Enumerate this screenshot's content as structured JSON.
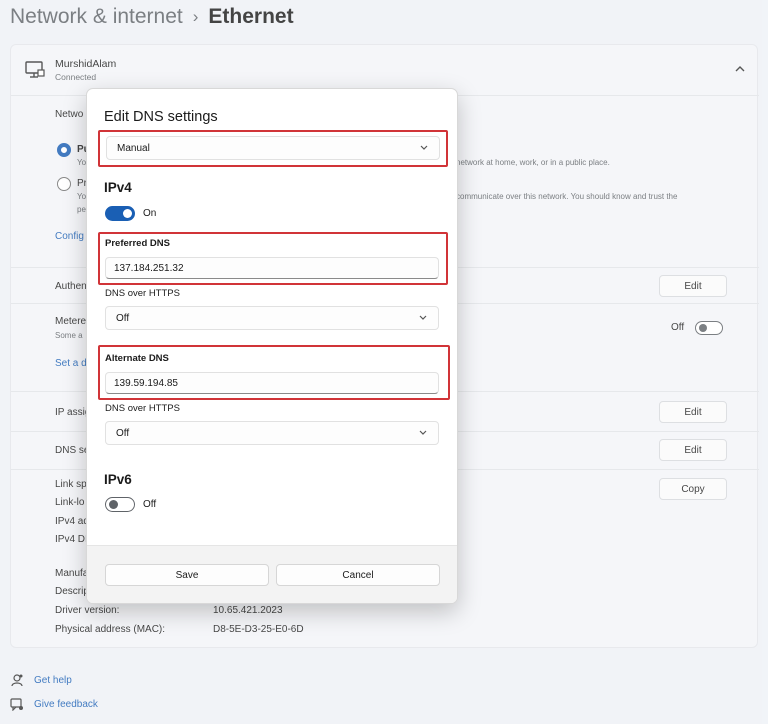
{
  "breadcrumb": {
    "parent": "Network & internet",
    "separator": "›",
    "current": "Ethernet"
  },
  "network": {
    "name": "MurshidAlam",
    "status": "Connected"
  },
  "background": {
    "network_profile_label": "Netwo",
    "public_label": "Pu",
    "public_desc_start": "Yo",
    "public_desc_end": "network at home, work, or in a public place.",
    "private_label": "Pr",
    "private_desc_start": "Yo",
    "private_desc_cont": "pe",
    "private_desc_end": "communicate over this network. You should know and trust the",
    "configure_link": "Config",
    "auth_label": "Authen",
    "auth_button": "Edit",
    "metered_label": "Metere",
    "metered_desc": "Some a",
    "metered_toggle_label": "Off",
    "data_limit_link": "Set a d",
    "ip_label": "IP assig",
    "ip_button": "Edit",
    "dns_label": "DNS se",
    "dns_button": "Edit",
    "link_speed": "Link sp",
    "link_local": "Link-lo",
    "ipv4_addr": "IPv4 ad",
    "ipv4_dns": "IPv4 DI",
    "copy_button": "Copy",
    "manufacturer": "Manufa",
    "description": "Descrip",
    "driver_label": "Driver version:",
    "driver_value": "10.65.421.2023",
    "mac_label": "Physical address (MAC):",
    "mac_value": "D8-5E-D3-25-E0-6D"
  },
  "help": {
    "get_help": "Get help",
    "give_feedback": "Give feedback"
  },
  "dialog": {
    "title": "Edit DNS settings",
    "mode": "Manual",
    "ipv4": {
      "heading": "IPv4",
      "toggle_label": "On",
      "preferred_label": "Preferred DNS",
      "preferred_value": "137.184.251.32",
      "doh1_label": "DNS over HTTPS",
      "doh1_value": "Off",
      "alternate_label": "Alternate DNS",
      "alternate_value": "139.59.194.85",
      "doh2_label": "DNS over HTTPS",
      "doh2_value": "Off"
    },
    "ipv6": {
      "heading": "IPv6",
      "toggle_label": "Off"
    },
    "save_label": "Save",
    "cancel_label": "Cancel"
  },
  "colors": {
    "accent": "#1a5fb4",
    "highlight": "#d13438",
    "link": "#1a5fb4"
  }
}
